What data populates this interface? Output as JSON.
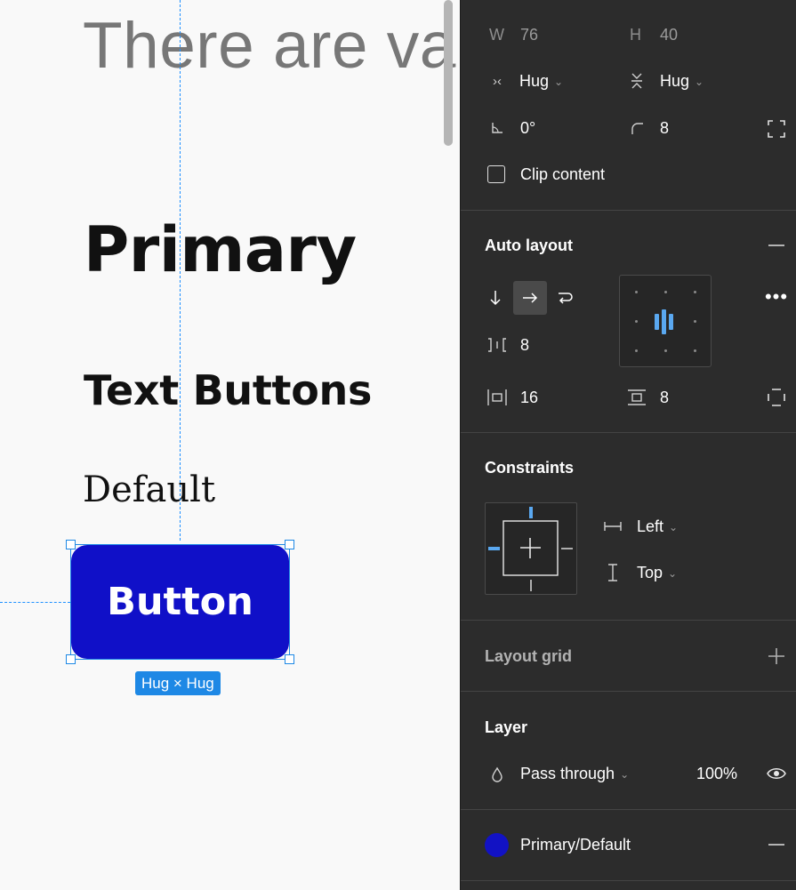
{
  "canvas": {
    "big_text": "There are va",
    "heading_primary": "Primary",
    "heading_text_buttons": "Text Buttons",
    "heading_default": "Default",
    "button_label": "Button",
    "size_badge": "Hug × Hug",
    "button_color": "#1010c8",
    "selection_color": "#1e88e5"
  },
  "panel": {
    "frame": {
      "w_label": "W",
      "w_value": "76",
      "h_label": "H",
      "h_value": "40",
      "width_mode": "Hug",
      "height_mode": "Hug",
      "rotation": "0°",
      "radius": "8",
      "clip_label": "Clip content"
    },
    "auto_layout": {
      "title": "Auto layout",
      "gap": "8",
      "h_padding": "16",
      "v_padding": "8"
    },
    "constraints": {
      "title": "Constraints",
      "horizontal": "Left",
      "vertical": "Top"
    },
    "layout_grid": {
      "title": "Layout grid"
    },
    "layer": {
      "title": "Layer",
      "blend": "Pass through",
      "opacity": "100%"
    },
    "fill": {
      "style_name": "Primary/Default",
      "color": "#1212c4"
    }
  }
}
